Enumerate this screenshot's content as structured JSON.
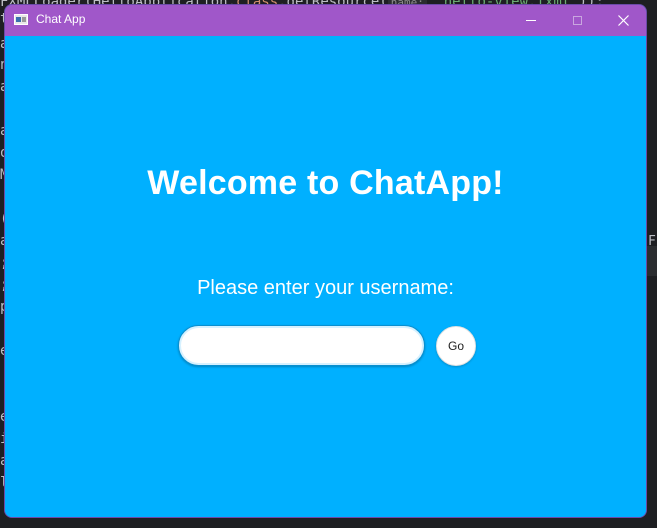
{
  "background_editor": {
    "top_line_prefix": "FXMLLoader(HelloApplication.",
    "top_line_keyword": "class",
    "top_line_mid": ".getResource(",
    "top_line_hint": "name:",
    "top_line_string": "\"hello-view.fxml\"",
    "top_line_suffix": "));",
    "left_chars": [
      "t",
      "a",
      "n",
      "a",
      "",
      "a",
      "o",
      "M",
      "",
      "(",
      "a",
      ";",
      ";",
      "p",
      "",
      "e",
      "",
      "",
      "e",
      "i",
      "a",
      "l"
    ],
    "right_char": "F"
  },
  "window": {
    "title": "Chat App",
    "icon": "java-app-icon",
    "controls": {
      "minimize_icon": "minimize-icon",
      "maximize_icon": "maximize-icon",
      "close_icon": "close-icon"
    }
  },
  "main": {
    "heading": "Welcome to ChatApp!",
    "prompt": "Please enter your username:",
    "username_input": {
      "value": "",
      "placeholder": ""
    },
    "go_button_label": "Go"
  },
  "colors": {
    "titlebar": "#a057c9",
    "content_background": "#00b0ff",
    "text": "#ffffff",
    "editor_background": "#1e1f22"
  }
}
